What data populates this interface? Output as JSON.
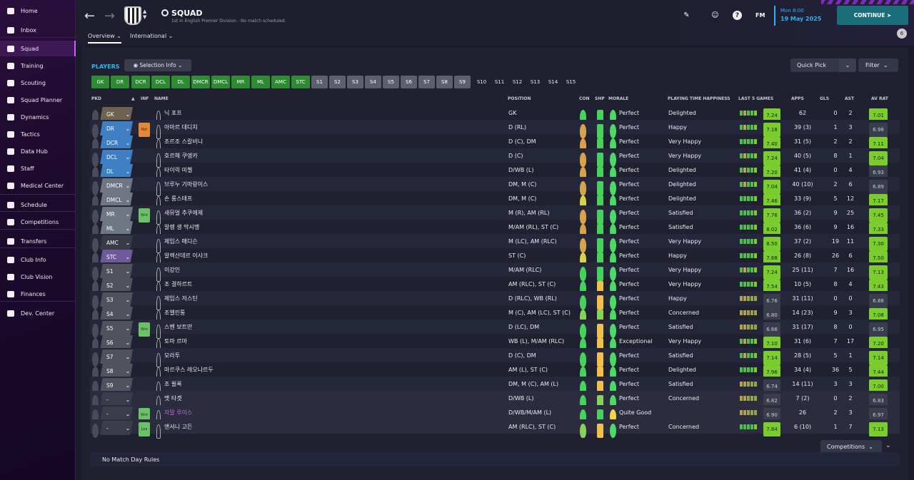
{
  "sidebar": {
    "items": [
      {
        "label": "Home",
        "icon": "home-icon"
      },
      {
        "label": "Inbox",
        "icon": "inbox-icon"
      },
      {
        "label": "Squad",
        "icon": "shirt-icon",
        "active": true
      },
      {
        "label": "Training",
        "icon": "cone-icon"
      },
      {
        "label": "Scouting",
        "icon": "binoculars-icon"
      },
      {
        "label": "Squad Planner",
        "icon": "clipboard-icon"
      },
      {
        "label": "Dynamics",
        "icon": "people-icon"
      },
      {
        "label": "Tactics",
        "icon": "tactics-board-icon"
      },
      {
        "label": "Data Hub",
        "icon": "data-circle-icon"
      },
      {
        "label": "Staff",
        "icon": "staff-icon"
      },
      {
        "label": "Medical Center",
        "icon": "medical-kit-icon"
      },
      {
        "label": "Schedule",
        "icon": "calendar-icon"
      },
      {
        "label": "Competitions",
        "icon": "trophy-icon"
      },
      {
        "label": "Transfers",
        "icon": "transfer-arrows-icon"
      },
      {
        "label": "Club Info",
        "icon": "shield-icon"
      },
      {
        "label": "Club Vision",
        "icon": "briefcase-icon"
      },
      {
        "label": "Finances",
        "icon": "money-icon"
      },
      {
        "label": "Dev. Center",
        "icon": "growth-icon"
      }
    ]
  },
  "header": {
    "title": "SQUAD",
    "subtitle": "1st in English Premier Division - No match scheduled.",
    "tabs": [
      {
        "label": "Overview"
      },
      {
        "label": "International"
      }
    ],
    "fm_logo": "FM",
    "date_day": "Mon 8:00",
    "date_full": "19 May 2025",
    "continue_label": "CONTINUE",
    "notification_count": "6"
  },
  "players_label": "PLAYERS",
  "selection_info_label": "Selection Info",
  "quick_pick_label": "Quick Pick",
  "filter_label": "Filter",
  "position_chips": [
    "GK",
    "DR",
    "DCR",
    "DCL",
    "DL",
    "DMCR",
    "DMCL",
    "MR",
    "ML",
    "AMC",
    "STC",
    "S1",
    "S2",
    "S3",
    "S4",
    "S5",
    "S6",
    "S7",
    "S8",
    "S9",
    "S10",
    "S11",
    "S12",
    "S13",
    "S14",
    "S15"
  ],
  "columns": {
    "pkd": "PKD",
    "inf": "INF",
    "name": "NAME",
    "position": "POSITION",
    "con": "CON",
    "shp": "SHP",
    "morale": "MORALE",
    "happiness": "PLAYING TIME HAPPINESS",
    "last5": "LAST 5 GAMES",
    "apps": "APPS",
    "gls": "GLS",
    "ast": "AST",
    "avrat": "AV RAT"
  },
  "rows": [
    {
      "pos": "GK",
      "inf": "",
      "name": "닉 포프",
      "position": "GK",
      "morale": "Perfect",
      "happiness": "Delighted",
      "last5": "7.24",
      "apps": "62",
      "gls": "0",
      "ast": "2",
      "avrat": "7.01"
    },
    {
      "pos": "DR",
      "inf": "Rot",
      "name": "아마르 데디치",
      "position": "D (RL)",
      "morale": "Perfect",
      "happiness": "Happy",
      "last5": "7.18",
      "apps": "39 (3)",
      "gls": "1",
      "ast": "3",
      "avrat": "6.98"
    },
    {
      "pos": "DCR",
      "inf": "",
      "name": "조르조 스칼비니",
      "position": "D (C), DM",
      "morale": "Perfect",
      "happiness": "Very Happy",
      "last5": "7.40",
      "apps": "31 (5)",
      "gls": "2",
      "ast": "2",
      "avrat": "7.11"
    },
    {
      "pos": "DCL",
      "inf": "",
      "name": "호르헤 쿠엥카",
      "position": "D (C)",
      "morale": "Perfect",
      "happiness": "Very Happy",
      "last5": "7.24",
      "apps": "40 (5)",
      "gls": "8",
      "ast": "1",
      "avrat": "7.04"
    },
    {
      "pos": "DL",
      "inf": "",
      "name": "타이릭 미첼",
      "position": "D/WB (L)",
      "morale": "Perfect",
      "happiness": "Delighted",
      "last5": "7.20",
      "apps": "41 (4)",
      "gls": "0",
      "ast": "4",
      "avrat": "6.93"
    },
    {
      "pos": "DMCR",
      "inf": "",
      "name": "브루누 기마랑이스",
      "position": "DM, M (C)",
      "morale": "Perfect",
      "happiness": "Delighted",
      "last5": "7.04",
      "apps": "40 (10)",
      "gls": "2",
      "ast": "6",
      "avrat": "6.89"
    },
    {
      "pos": "DMCL",
      "inf": "",
      "name": "손 롱스태프",
      "position": "DM, M (C)",
      "morale": "Perfect",
      "happiness": "Delighted",
      "last5": "7.46",
      "apps": "33 (9)",
      "gls": "5",
      "ast": "12",
      "avrat": "7.17"
    },
    {
      "pos": "MR",
      "inf": "Wnt",
      "name": "새뮤얼 추쿠에제",
      "position": "M (R), AM (RL)",
      "morale": "Perfect",
      "happiness": "Satisfied",
      "last5": "7.76",
      "apps": "36 (2)",
      "gls": "9",
      "ast": "25",
      "avrat": "7.45"
    },
    {
      "pos": "ML",
      "inf": "",
      "name": "알렝 생 막시맹",
      "position": "M/AM (RL), ST (C)",
      "morale": "Perfect",
      "happiness": "Satisfied",
      "last5": "8.02",
      "apps": "36 (6)",
      "gls": "9",
      "ast": "16",
      "avrat": "7.33"
    },
    {
      "pos": "AMC",
      "inf": "",
      "name": "제임스 매디슨",
      "position": "M (LC), AM (RLC)",
      "morale": "Perfect",
      "happiness": "Very Happy",
      "last5": "8.50",
      "apps": "37 (2)",
      "gls": "19",
      "ast": "11",
      "avrat": "7.30"
    },
    {
      "pos": "STC",
      "inf": "",
      "name": "알렉산데르 이사크",
      "position": "ST (C)",
      "morale": "Perfect",
      "happiness": "Happy",
      "last5": "7.68",
      "apps": "26 (8)",
      "gls": "26",
      "ast": "6",
      "avrat": "7.50"
    },
    {
      "pos": "S1",
      "inf": "",
      "name": "이강인",
      "position": "M/AM (RLC)",
      "morale": "Perfect",
      "happiness": "Very Happy",
      "last5": "7.24",
      "apps": "25 (11)",
      "gls": "7",
      "ast": "16",
      "avrat": "7.13"
    },
    {
      "pos": "S2",
      "inf": "",
      "name": "조 결하르트",
      "position": "AM (RLC), ST (C)",
      "morale": "Perfect",
      "happiness": "Very Happy",
      "last5": "7.54",
      "apps": "10 (5)",
      "gls": "8",
      "ast": "4",
      "avrat": "7.43"
    },
    {
      "pos": "S3",
      "inf": "",
      "name": "제임스 저스틴",
      "position": "D (RLC), WB (RL)",
      "morale": "Perfect",
      "happiness": "Happy",
      "last5": "6.76",
      "apps": "31 (11)",
      "gls": "0",
      "ast": "0",
      "avrat": "6.88"
    },
    {
      "pos": "S4",
      "inf": "",
      "name": "조엘린통",
      "position": "M (C), AM (LC), ST (C)",
      "morale": "Perfect",
      "happiness": "Concerned",
      "last5": "6.80",
      "apps": "14 (23)",
      "gls": "9",
      "ast": "3",
      "avrat": "7.08"
    },
    {
      "pos": "S5",
      "inf": "Wnt",
      "name": "스벤 보트만",
      "position": "D (LC), DM",
      "morale": "Perfect",
      "happiness": "Satisfied",
      "last5": "6.66",
      "apps": "31 (17)",
      "gls": "8",
      "ast": "0",
      "avrat": "6.95"
    },
    {
      "pos": "S6",
      "inf": "",
      "name": "토마 르마",
      "position": "WB (L), M/AM (RLC)",
      "morale": "Exceptional",
      "happiness": "Very Happy",
      "last5": "7.10",
      "apps": "31 (6)",
      "gls": "7",
      "ast": "17",
      "avrat": "7.20"
    },
    {
      "pos": "S7",
      "inf": "",
      "name": "모라투",
      "position": "D (C), DM",
      "morale": "Perfect",
      "happiness": "Satisfied",
      "last5": "7.14",
      "apps": "28 (5)",
      "gls": "5",
      "ast": "1",
      "avrat": "7.14"
    },
    {
      "pos": "S8",
      "inf": "",
      "name": "마르쿠스 레오나르두",
      "position": "AM (L), ST (C)",
      "morale": "Perfect",
      "happiness": "Delighted",
      "last5": "7.96",
      "apps": "34 (4)",
      "gls": "36",
      "ast": "5",
      "avrat": "7.44"
    },
    {
      "pos": "S9",
      "inf": "",
      "name": "조 윌록",
      "position": "DM, M (C), AM (L)",
      "morale": "Perfect",
      "happiness": "Satisfied",
      "last5": "6.74",
      "apps": "14 (11)",
      "gls": "3",
      "ast": "3",
      "avrat": "7.00"
    },
    {
      "pos": "-",
      "inf": "",
      "name": "맷 타겟",
      "position": "D/WB (L)",
      "morale": "Perfect",
      "happiness": "Concerned",
      "last5": "6.82",
      "apps": "7 (2)",
      "gls": "0",
      "ast": "2",
      "avrat": "6.83"
    },
    {
      "pos": "-",
      "inf": "Wnt",
      "name": "자말 루이스",
      "position": "D/WB/M/AM (L)",
      "morale": "Quite Good",
      "happiness": "",
      "last5": "6.90",
      "apps": "26",
      "gls": "2",
      "ast": "3",
      "avrat": "6.97"
    },
    {
      "pos": "-",
      "inf": "Loa",
      "name": "앤서니 고든",
      "position": "AM (RLC), ST (C)",
      "morale": "Perfect",
      "happiness": "Concerned",
      "last5": "7.84",
      "apps": "6 (10)",
      "gls": "1",
      "ast": "7",
      "avrat": "7.13"
    }
  ],
  "competitions_label": "Competitions",
  "no_rules_label": "No Match Day Rules"
}
